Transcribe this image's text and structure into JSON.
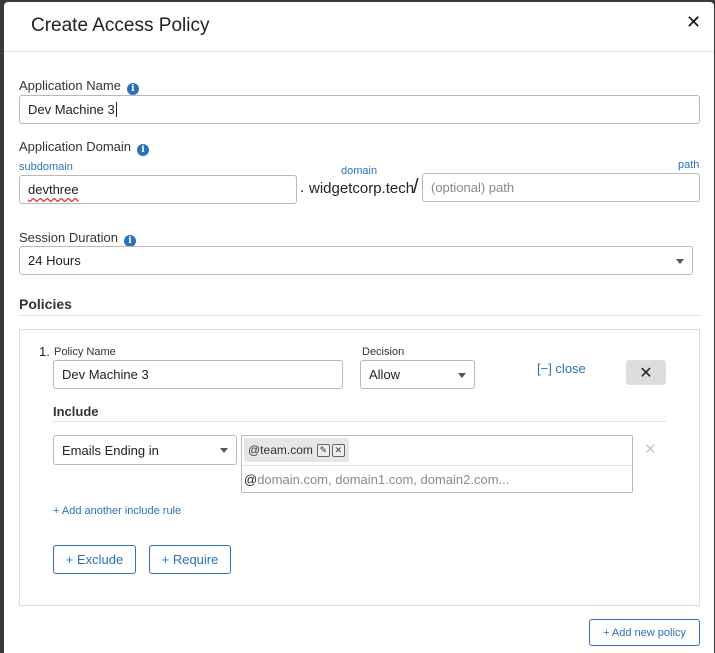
{
  "modal": {
    "title": "Create Access Policy",
    "close_glyph": "✕"
  },
  "app_name": {
    "label": "Application Name",
    "value": "Dev Machine 3"
  },
  "app_domain": {
    "label": "Application Domain",
    "subdomain_label": "subdomain",
    "subdomain_value": "devthree",
    "dot": ".",
    "domain_label": "domain",
    "domain_value": "widgetcorp.tech",
    "slash": "/",
    "path_label": "path",
    "path_placeholder": "(optional) path"
  },
  "session": {
    "label": "Session Duration",
    "value": "24 Hours"
  },
  "policies": {
    "title": "Policies",
    "items": [
      {
        "number": "1.",
        "name_label": "Policy Name",
        "name_value": "Dev Machine 3",
        "decision_label": "Decision",
        "decision_value": "Allow",
        "close_link": "[−] close",
        "remove_glyph": "✕",
        "include_title": "Include",
        "include_rule": {
          "type": "Emails Ending in",
          "tag": "@team.com",
          "at": "@",
          "placeholder": "domain.com, domain1.com, domain2.com..."
        },
        "remove_rule_glyph": "✕",
        "add_include": "+ Add another include rule",
        "exclude_button": "+ Exclude",
        "require_button": "+ Require"
      }
    ]
  },
  "add_policy_button": "+ Add new policy",
  "icons": {
    "info": "i",
    "edit": "✎",
    "tag_close": "✕"
  },
  "colors": {
    "accent": "#2a73b8",
    "backdrop": "#3a3a3a"
  }
}
